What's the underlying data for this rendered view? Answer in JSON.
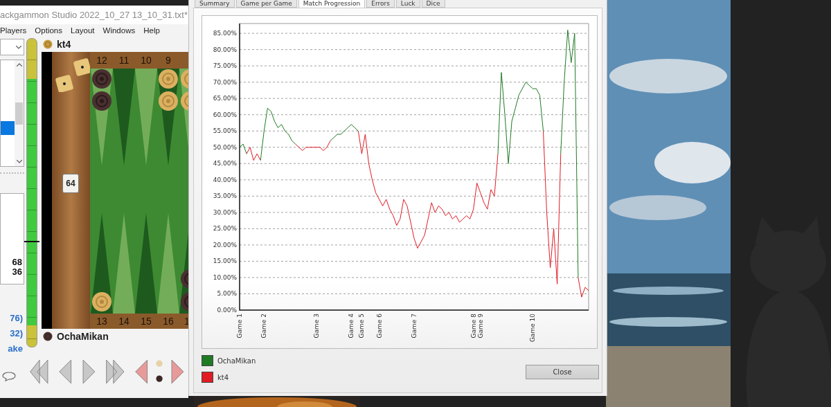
{
  "backgammon_window": {
    "title": "ackgammon Studio 2022_10_27 13_10_31.txt*",
    "menu": [
      "Players",
      "Options",
      "Layout",
      "Windows",
      "Help"
    ],
    "list_rows": [
      {
        "selected": false
      },
      {
        "selected": false
      },
      {
        "selected": false
      },
      {
        "selected": false
      },
      {
        "selected": true
      },
      {
        "selected": false
      },
      {
        "selected": false
      }
    ],
    "score_lines": [
      "68",
      "36"
    ],
    "links": [
      "76)",
      "32)",
      "ake"
    ],
    "meter": {
      "level": 0.34
    },
    "top_player": "kt4",
    "bottom_player": "OchaMikan",
    "top_points": [
      "12",
      "11",
      "10",
      "9"
    ],
    "bottom_points": [
      "13",
      "14",
      "15",
      "16",
      "1"
    ],
    "cube": "64"
  },
  "stats_dialog": {
    "tabs": [
      {
        "label": "Summary",
        "selected": false
      },
      {
        "label": "Game per Game",
        "selected": false
      },
      {
        "label": "Match Progression",
        "selected": true
      },
      {
        "label": "Errors",
        "selected": false
      },
      {
        "label": "Luck",
        "selected": false
      },
      {
        "label": "Dice",
        "selected": false
      }
    ],
    "chart_data": {
      "type": "line",
      "grid": true,
      "ylim": [
        0,
        88
      ],
      "categories": [
        "Game 1",
        null,
        null,
        null,
        null,
        null,
        null,
        "Game 2",
        null,
        null,
        null,
        null,
        null,
        null,
        null,
        null,
        null,
        null,
        null,
        null,
        null,
        null,
        "Game 3",
        null,
        null,
        null,
        null,
        null,
        null,
        null,
        null,
        null,
        "Game 4",
        null,
        null,
        "Game 5",
        null,
        null,
        null,
        null,
        "Game 6",
        null,
        null,
        null,
        null,
        null,
        null,
        null,
        null,
        null,
        "Game 7",
        null,
        null,
        null,
        null,
        null,
        null,
        null,
        null,
        null,
        null,
        null,
        null,
        null,
        null,
        null,
        null,
        "Game 8",
        null,
        "Game 9",
        null,
        null,
        null,
        null,
        null,
        null,
        null,
        null,
        null,
        null,
        null,
        null,
        null,
        null,
        "Game 10",
        null,
        null,
        null,
        null,
        null,
        null,
        null,
        null,
        null,
        null,
        null,
        null,
        null,
        null,
        null,
        null
      ],
      "yticks": [
        {
          "value": 0,
          "label": "0.00%"
        },
        {
          "value": 5,
          "label": "5.00%"
        },
        {
          "value": 10,
          "label": "10.00%"
        },
        {
          "value": 15,
          "label": "15.00%"
        },
        {
          "value": 20,
          "label": "20.00%"
        },
        {
          "value": 25,
          "label": "25.00%"
        },
        {
          "value": 30,
          "label": "30.00%"
        },
        {
          "value": 35,
          "label": "35.00%"
        },
        {
          "value": 40,
          "label": "40.00%"
        },
        {
          "value": 45,
          "label": "45.00%"
        },
        {
          "value": 50,
          "label": "50.00%"
        },
        {
          "value": 55,
          "label": "55.00%"
        },
        {
          "value": 60,
          "label": "60.00%"
        },
        {
          "value": 65,
          "label": "65.00%"
        },
        {
          "value": 70,
          "label": "70.00%"
        },
        {
          "value": 75,
          "label": "75.00%"
        },
        {
          "value": 80,
          "label": "80.00%"
        },
        {
          "value": 85,
          "label": "85.00%"
        }
      ],
      "series": [
        {
          "name": "OchaMikan",
          "color": "#1f7a24",
          "values": [
            50,
            51,
            48,
            null,
            null,
            null,
            46,
            55,
            62,
            61,
            58,
            56,
            57,
            55,
            54,
            52,
            51,
            null,
            null,
            null,
            null,
            null,
            null,
            null,
            null,
            null,
            52,
            53,
            54,
            54,
            55,
            56,
            57,
            56,
            55,
            null,
            null,
            null,
            null,
            null,
            null,
            null,
            null,
            null,
            null,
            null,
            null,
            null,
            null,
            null,
            null,
            null,
            null,
            null,
            null,
            null,
            null,
            null,
            null,
            null,
            null,
            null,
            null,
            null,
            null,
            null,
            null,
            null,
            null,
            null,
            null,
            null,
            null,
            null,
            48,
            73,
            60,
            45,
            58,
            62,
            66,
            68,
            70,
            69,
            68,
            68,
            66,
            55,
            null,
            null,
            null,
            null,
            48,
            70,
            86,
            76,
            85,
            10,
            null,
            null,
            null
          ]
        },
        {
          "name": "kt4",
          "color": "#e01b24",
          "values": [
            null,
            null,
            48,
            50,
            46,
            48,
            46,
            null,
            null,
            null,
            null,
            null,
            null,
            null,
            null,
            null,
            51,
            50,
            49,
            50,
            50,
            50,
            50,
            50,
            49,
            50,
            52,
            null,
            null,
            null,
            null,
            null,
            null,
            null,
            55,
            48,
            54,
            45,
            40,
            36,
            34,
            32,
            34,
            31,
            29,
            26,
            28,
            34,
            32,
            27,
            22,
            19,
            21,
            23,
            28,
            33,
            30,
            32,
            31,
            29,
            30,
            28,
            29,
            27,
            28,
            29,
            28,
            31,
            39,
            36,
            33,
            31,
            37,
            35,
            48,
            null,
            null,
            null,
            null,
            null,
            null,
            null,
            null,
            null,
            null,
            null,
            null,
            55,
            30,
            13,
            25,
            8,
            48,
            null,
            null,
            null,
            null,
            10,
            4,
            7,
            6
          ]
        }
      ]
    },
    "close_button": "Close"
  }
}
